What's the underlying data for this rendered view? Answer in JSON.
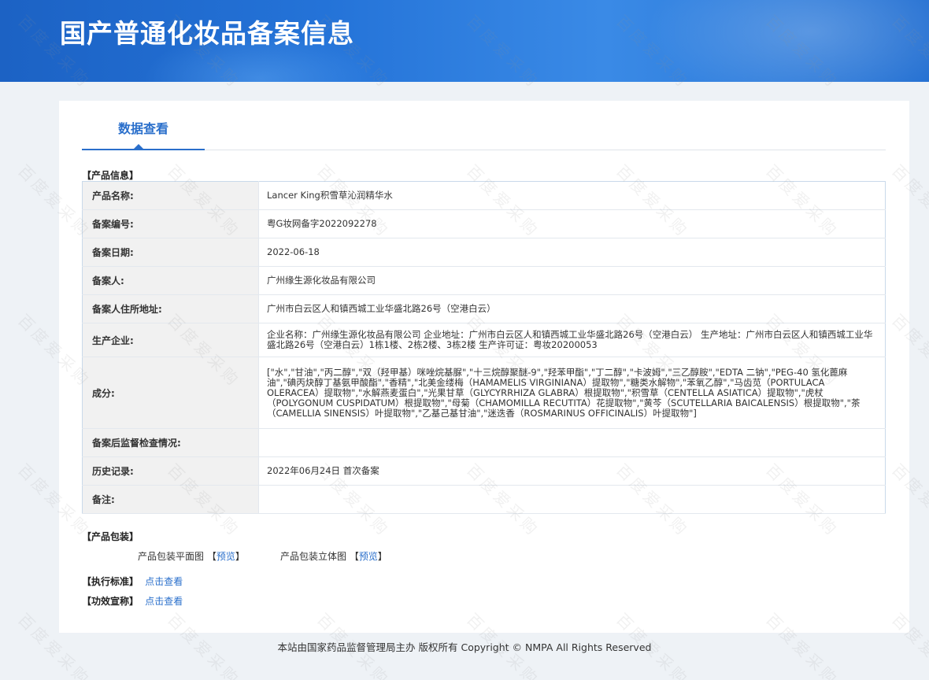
{
  "header": {
    "title": "国产普通化妆品备案信息"
  },
  "tabs": [
    {
      "label": "数据查看"
    }
  ],
  "sections": {
    "product_info": "【产品信息】",
    "packaging": "【产品包装】",
    "standard": "【执行标准】",
    "efficacy": "【功效宣称】"
  },
  "rows": [
    {
      "label": "产品名称:",
      "value": "Lancer King积雪草沁润精华水"
    },
    {
      "label": "备案编号:",
      "value": "粤G妆网备字2022092278"
    },
    {
      "label": "备案日期:",
      "value": "2022-06-18"
    },
    {
      "label": "备案人:",
      "value": "广州缘生源化妆品有限公司"
    },
    {
      "label": "备案人住所地址:",
      "value": "广州市白云区人和镇西城工业华盛北路26号（空港白云）"
    },
    {
      "label": "生产企业:",
      "value": "企业名称：广州缘生源化妆品有限公司 企业地址：广州市白云区人和镇西城工业华盛北路26号（空港白云） 生产地址：广州市白云区人和镇西城工业华盛北路26号（空港白云）1栋1楼、2栋2楼、3栋2楼 生产许可证：粤妆20200053"
    },
    {
      "label": "成分:",
      "value": "[\"水\",\"甘油\",\"丙二醇\",\"双（羟甲基）咪唑烷基脲\",\"十三烷醇聚醚-9\",\"羟苯甲酯\",\"丁二醇\",\"卡波姆\",\"三乙醇胺\",\"EDTA 二钠\",\"PEG-40 氢化蓖麻油\",\"碘丙炔醇丁基氨甲酸酯\",\"香精\",\"北美金缕梅（HAMAMELIS VIRGINIANA）提取物\",\"糖类水解物\",\"苯氧乙醇\",\"马齿苋（PORTULACA OLERACEA）提取物\",\"水解燕麦蛋白\",\"光果甘草（GLYCYRRHIZA GLABRA）根提取物\",\"积雪草（CENTELLA ASIATICA）提取物\",\"虎杖（POLYGONUM CUSPIDATUM）根提取物\",\"母菊（CHAMOMILLA RECUTITA）花提取物\",\"黄芩（SCUTELLARIA BAICALENSIS）根提取物\",\"茶（CAMELLIA SINENSIS）叶提取物\",\"乙基己基甘油\",\"迷迭香（ROSMARINUS OFFICINALIS）叶提取物\"]"
    },
    {
      "label": "备案后监督检查情况:",
      "value": ""
    },
    {
      "label": "历史记录:",
      "value": "2022年06月24日 首次备案"
    },
    {
      "label": "备注:",
      "value": ""
    }
  ],
  "packaging": {
    "flat_label": "产品包装平面图",
    "solid_label": "产品包装立体图",
    "bracket_open": "【",
    "bracket_close": "】",
    "preview": "预览"
  },
  "links": {
    "view": "点击查看"
  },
  "footer": {
    "text": "本站由国家药品监督管理局主办 版权所有 Copyright © NMPA All Rights Reserved"
  },
  "watermark": {
    "text": "百度爱采购"
  }
}
